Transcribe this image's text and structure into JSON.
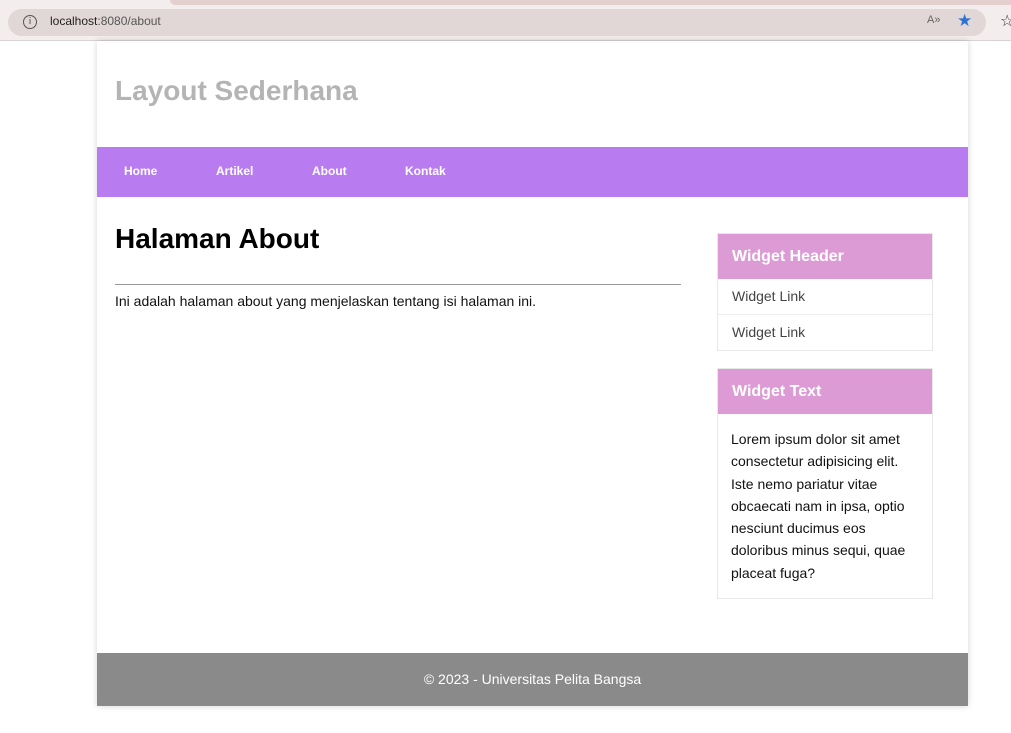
{
  "browser": {
    "url_host": "localhost",
    "url_rest": ":8080/about",
    "info_icon": "i",
    "read_aloud_icon": "A»",
    "favorite_icon": "★",
    "favorites_icon": "☆"
  },
  "site": {
    "title": "Layout Sederhana"
  },
  "nav": {
    "items": [
      {
        "label": "Home"
      },
      {
        "label": "Artikel"
      },
      {
        "label": "About"
      },
      {
        "label": "Kontak"
      }
    ]
  },
  "main": {
    "heading": "Halaman About",
    "text": "Ini adalah halaman about yang menjelaskan tentang isi halaman ini."
  },
  "sidebar": {
    "widget1": {
      "header": "Widget Header",
      "links": [
        {
          "label": "Widget Link"
        },
        {
          "label": "Widget Link"
        }
      ]
    },
    "widget2": {
      "header": "Widget Text",
      "body": "Lorem ipsum dolor sit amet consectetur adipisicing elit. Iste nemo pariatur vitae obcaecati nam in ipsa, optio nesciunt ducimus eos doloribus minus sequi, quae placeat fuga?"
    }
  },
  "footer": {
    "text": "© 2023 - Universitas Pelita Bangsa"
  },
  "colors": {
    "nav": "#b87cf0",
    "widget_header": "#dd9bd6",
    "footer": "#8a8a8a",
    "title": "#b4b4b4"
  }
}
